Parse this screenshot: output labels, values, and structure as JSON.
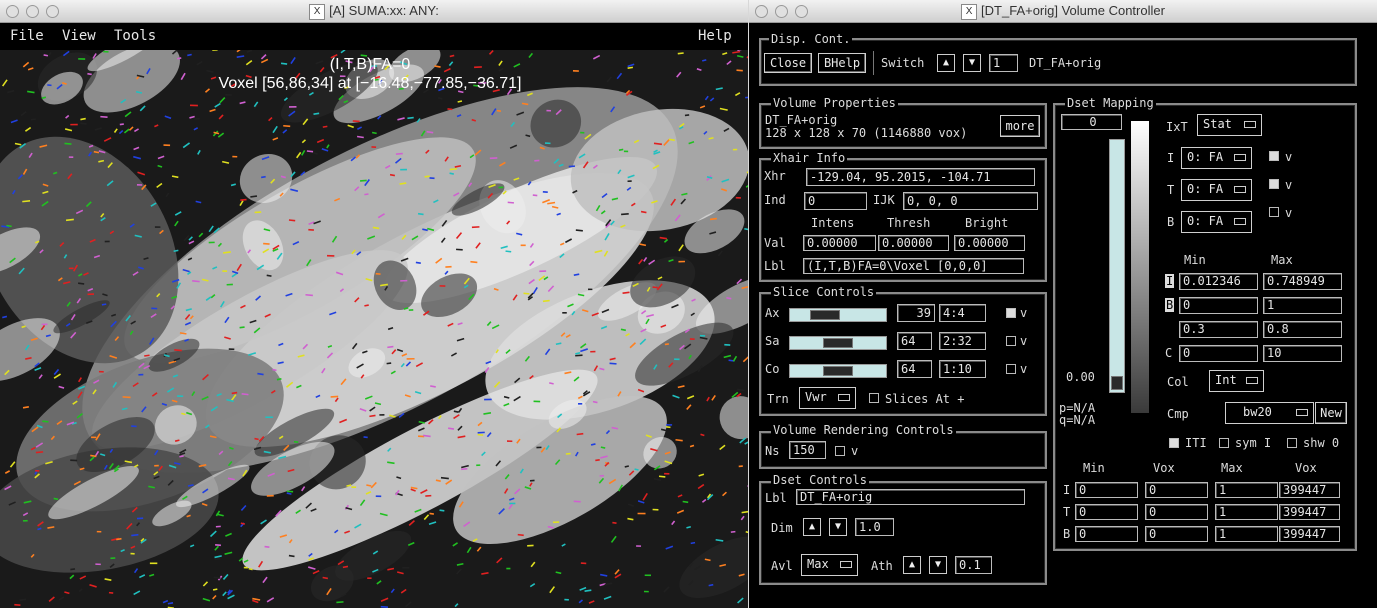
{
  "suma": {
    "title": "[A] SUMA:xx: ANY:",
    "menu": {
      "file": "File",
      "view": "View",
      "tools": "Tools",
      "help": "Help"
    },
    "overlay_line1": "(I,T,B)FA=0",
    "overlay_line2": "Voxel [56,86,34] at [−16.48,−77.85,−36.71]"
  },
  "ctrl": {
    "title": "[DT_FA+orig] Volume Controller",
    "disp": {
      "label": "Disp. Cont.",
      "close": "Close",
      "bhelp": "BHelp",
      "switch": "Switch",
      "switch_value": "1",
      "dset_name": "DT_FA+orig"
    },
    "volprops": {
      "label": "Volume Properties",
      "name": "DT_FA+orig",
      "dims": "128 x 128 x 70 (1146880 vox)",
      "more": "more"
    },
    "xhair": {
      "label": "Xhair Info",
      "xhr_label": "Xhr",
      "xhr_value": "-129.04, 95.2015, -104.71",
      "ind_label": "Ind",
      "ind_value": "0",
      "ijk_label": "IJK",
      "ijk_value": "0, 0, 0",
      "col_intens": "Intens",
      "col_thresh": "Thresh",
      "col_bright": "Bright",
      "val_label": "Val",
      "val_intens": "0.00000",
      "val_thresh": "0.00000",
      "val_bright": "0.00000",
      "lbl_label": "Lbl",
      "lbl_value": "(I,T,B)FA=0\\Voxel [0,0,0]"
    },
    "slice": {
      "label": "Slice Controls",
      "ax_label": "Ax",
      "ax_value": "39",
      "ax_range": "4:4",
      "ax_pos": 0.3,
      "sa_label": "Sa",
      "sa_value": "64",
      "sa_range": "2:32",
      "sa_pos": 0.5,
      "co_label": "Co",
      "co_value": "64",
      "co_range": "1:10",
      "co_pos": 0.5,
      "v": "v",
      "trn_label": "Trn",
      "trn_value": "Vwr",
      "slices_at": "Slices At +"
    },
    "vrc": {
      "label": "Volume Rendering Controls",
      "ns_label": "Ns",
      "ns_value": "150",
      "v": "v"
    },
    "dset": {
      "label": "Dset Controls",
      "lbl_label": "Lbl",
      "lbl_value": "DT_FA+orig",
      "dim_label": "Dim",
      "dim_value": "1.0",
      "avl_label": "Avl",
      "avl_value": "Max",
      "ath_label": "Ath",
      "ath_value": "0.1"
    },
    "mapping": {
      "label": "Dset Mapping",
      "top_value": "0",
      "bottom_value": "0.00",
      "p": "p=N/A",
      "q": "q=N/A",
      "ixt_label": "IxT",
      "ixt_value": "Stat",
      "i_label": "I",
      "i_value": "0: FA",
      "t_label": "T",
      "t_value": "0: FA",
      "b_label": "B",
      "b_value": "0: FA",
      "v": "v",
      "min_header": "Min",
      "max_header": "Max",
      "i_min": "0.012346",
      "i_max": "0.748949",
      "b_min": "0",
      "b_max": "1",
      "r3_min": "0.3",
      "r3_max": "0.8",
      "c_label": "C",
      "c_min": "0",
      "c_max": "10",
      "col_label": "Col",
      "col_value": "Int",
      "cmp_label": "Cmp",
      "cmp_value": "bw20",
      "new": "New",
      "iti": "ITI",
      "sym": "sym I",
      "shw": "shw 0",
      "table_headers": [
        "Min",
        "Vox",
        "Max",
        "Vox"
      ],
      "rows": [
        {
          "label": "I",
          "min": "0",
          "minvox": "0",
          "max": "1",
          "maxvox": "399447"
        },
        {
          "label": "T",
          "min": "0",
          "minvox": "0",
          "max": "1",
          "maxvox": "399447"
        },
        {
          "label": "B",
          "min": "0",
          "minvox": "0",
          "max": "1",
          "maxvox": "399447"
        }
      ]
    }
  }
}
